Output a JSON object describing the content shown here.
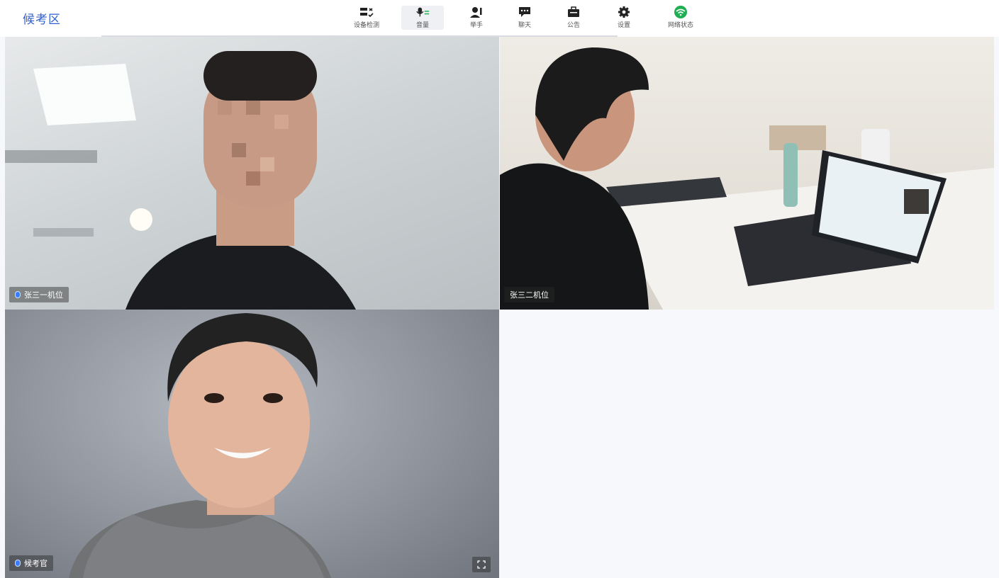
{
  "app": {
    "title": "候考区"
  },
  "toolbar": {
    "items": [
      {
        "label": "设备检测",
        "icon": "device-check-icon"
      },
      {
        "label": "音量",
        "icon": "microphone-icon"
      },
      {
        "label": "举手",
        "icon": "raise-hand-icon"
      },
      {
        "label": "聊天",
        "icon": "chat-icon"
      },
      {
        "label": "公告",
        "icon": "announcement-icon"
      },
      {
        "label": "设置",
        "icon": "gear-icon"
      },
      {
        "label": "网络状态",
        "icon": "wifi-icon"
      }
    ]
  },
  "videos": [
    {
      "name": "张三一机位",
      "has_mic": true
    },
    {
      "name": "张三二机位",
      "has_mic": false
    },
    {
      "name": "候考官",
      "has_mic": true
    }
  ],
  "colors": {
    "accent": "#2f5fcf",
    "network_good": "#1fae51"
  }
}
